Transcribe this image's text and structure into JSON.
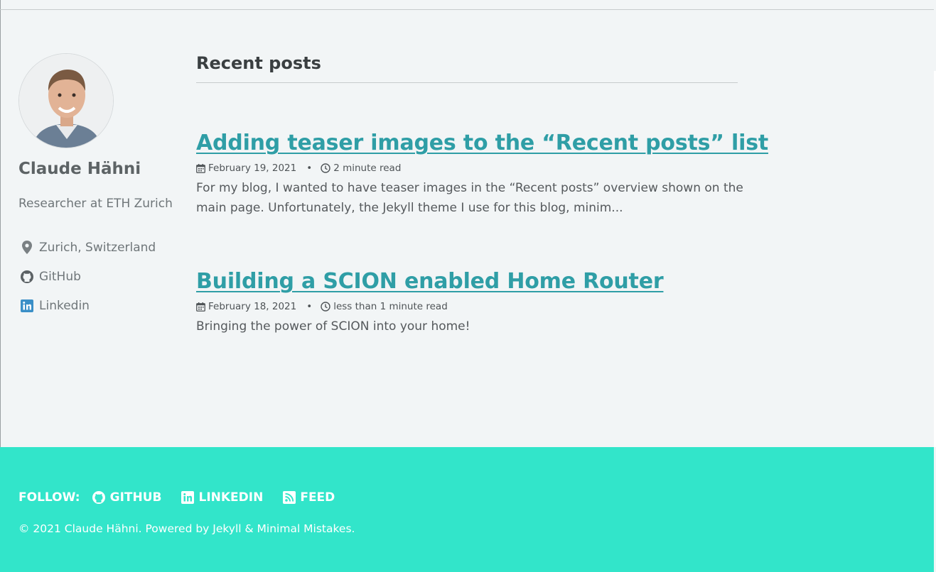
{
  "author": {
    "name": "Claude Hähni",
    "bio": "Researcher at ETH Zurich",
    "links": [
      {
        "label": "Zurich, Switzerland",
        "icon": "map-marker-icon"
      },
      {
        "label": "GitHub",
        "icon": "github-icon"
      },
      {
        "label": "Linkedin",
        "icon": "linkedin-icon"
      }
    ]
  },
  "main": {
    "section_title": "Recent posts",
    "posts": [
      {
        "title": "Adding teaser images to the “Recent posts” list",
        "date": "February 19, 2021",
        "read_time": "2 minute read",
        "excerpt": "For my blog, I wanted to have teaser images in the “Recent posts” overview shown on the main page. Unfortunately, the Jekyll theme I use for this blog, minim..."
      },
      {
        "title": "Building a SCION enabled Home Router",
        "date": "February 18, 2021",
        "read_time": "less than 1 minute read",
        "excerpt": "Bringing the power of SCION into your home!"
      }
    ]
  },
  "footer": {
    "follow_label": "FOLLOW:",
    "links": [
      {
        "label": "GITHUB",
        "icon": "github-icon"
      },
      {
        "label": "LINKEDIN",
        "icon": "linkedin-icon"
      },
      {
        "label": "FEED",
        "icon": "rss-icon"
      }
    ],
    "copyright": "© 2021 Claude Hähni. Powered by Jekyll & Minimal Mistakes."
  },
  "colors": {
    "link": "#2f9ea6",
    "footer_bg": "#32e5ca",
    "page_bg": "#f2f5f6",
    "linkedin_blue": "#3a8fc7"
  }
}
